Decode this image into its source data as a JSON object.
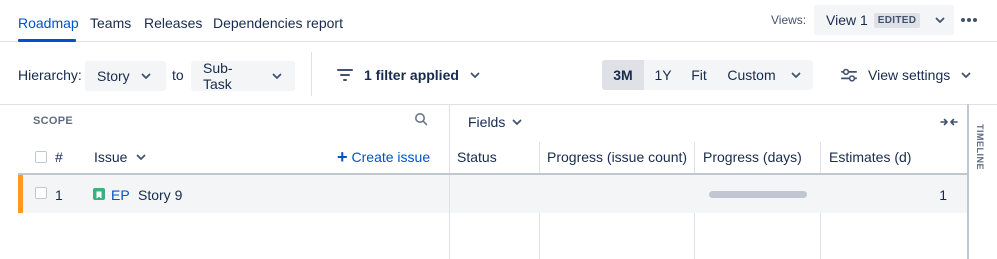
{
  "nav": {
    "tabs": [
      {
        "label": "Roadmap",
        "active": true
      },
      {
        "label": "Teams",
        "active": false
      },
      {
        "label": "Releases",
        "active": false
      },
      {
        "label": "Dependencies report",
        "active": false
      }
    ],
    "views_label": "Views:",
    "current_view": "View 1",
    "view_badge": "EDITED",
    "more_icon": "more-horizontal-icon"
  },
  "toolbar": {
    "hierarchy_label": "Hierarchy:",
    "hierarchy_from": "Story",
    "to_label": "to",
    "hierarchy_to": "Sub-Task",
    "filter_label": "1 filter applied",
    "timescale_options": [
      {
        "label": "3M",
        "selected": true
      },
      {
        "label": "1Y",
        "selected": false
      },
      {
        "label": "Fit",
        "selected": false
      },
      {
        "label": "Custom",
        "selected": false
      }
    ],
    "view_settings_label": "View settings"
  },
  "grid": {
    "scope_label": "SCOPE",
    "fields_label": "Fields",
    "timeline_label": "TIMELINE",
    "columns": {
      "number": "#",
      "issue": "Issue",
      "create_issue": "Create issue",
      "status": "Status",
      "progress_count": "Progress (issue count)",
      "progress_days": "Progress (days)",
      "estimates": "Estimates (d)"
    },
    "rows": [
      {
        "number": "1",
        "issue_type": "EP",
        "title": "Story 9",
        "status": "",
        "progress_count": "",
        "progress_days_fraction": 0,
        "estimate": "1"
      }
    ]
  },
  "colors": {
    "accent": "#0052cc",
    "row_marker": "#ff991f",
    "epic": "#36b37e",
    "border": "#dfe1e6"
  }
}
